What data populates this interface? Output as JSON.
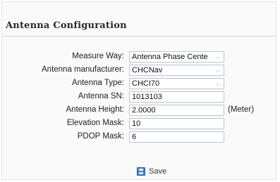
{
  "panel": {
    "title": "Antenna Configuration"
  },
  "form": {
    "measure_way": {
      "label": "Measure Way:",
      "value": "Antenna Phase Cente"
    },
    "antenna_manufacturer": {
      "label": "Antenna manufacturer:",
      "value": "CHCNav"
    },
    "antenna_type": {
      "label": "Antenna Type:",
      "value": "CHCI70"
    },
    "antenna_sn": {
      "label": "Antenna SN:",
      "value": "1013103"
    },
    "antenna_height": {
      "label": "Antenna Height:",
      "value": "2.0000",
      "unit": "(Meter)"
    },
    "elevation_mask": {
      "label": "Elevation Mask:",
      "value": "10"
    },
    "pdop_mask": {
      "label": "PDOP Mask:",
      "value": "6"
    }
  },
  "actions": {
    "save_label": "Save",
    "save_icon": "floppy-disk-icon"
  },
  "colors": {
    "field_border": "#b9c7d6",
    "chevron": "#7aa5d3",
    "save_icon": "#3f7fd0"
  }
}
